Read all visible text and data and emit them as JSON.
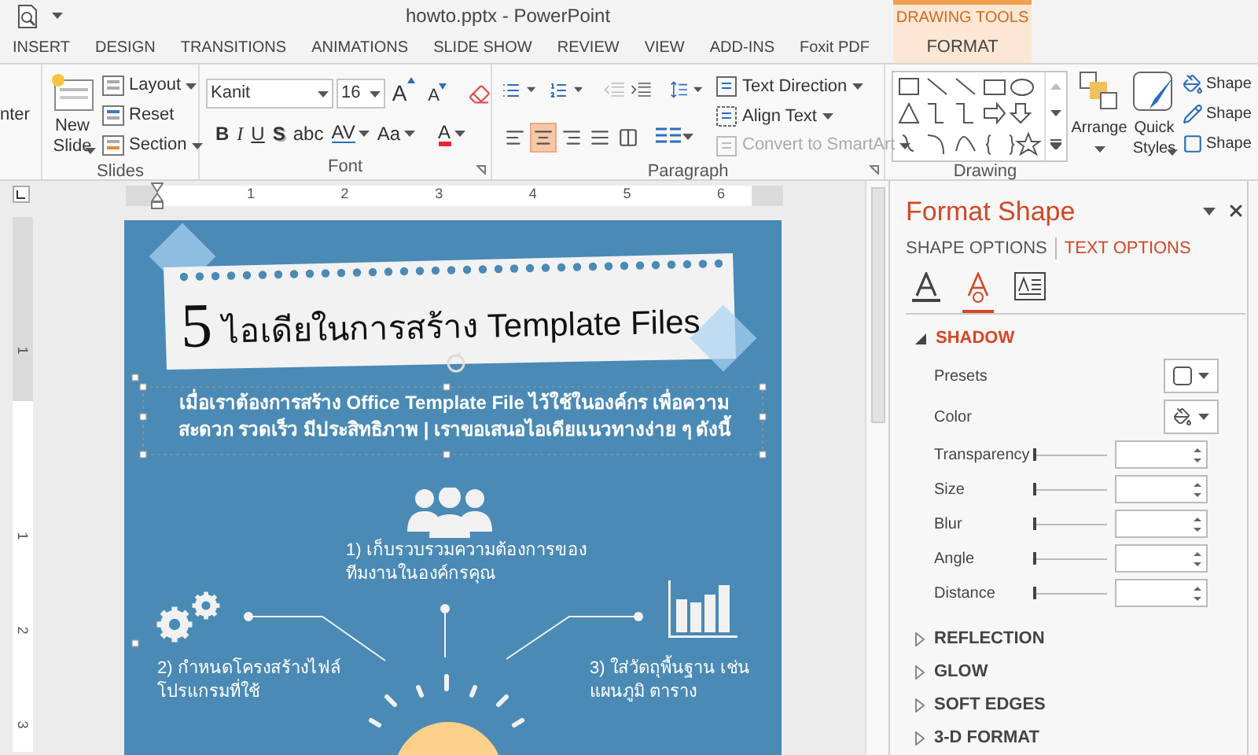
{
  "window": {
    "title": "howto.pptx - PowerPoint"
  },
  "contextual_group": {
    "label": "DRAWING TOOLS"
  },
  "ribbon_tabs": [
    {
      "label": "INSERT",
      "contextual": false
    },
    {
      "label": "DESIGN",
      "contextual": false
    },
    {
      "label": "TRANSITIONS",
      "contextual": false
    },
    {
      "label": "ANIMATIONS",
      "contextual": false
    },
    {
      "label": "SLIDE SHOW",
      "contextual": false
    },
    {
      "label": "REVIEW",
      "contextual": false
    },
    {
      "label": "VIEW",
      "contextual": false
    },
    {
      "label": "ADD-INS",
      "contextual": false
    },
    {
      "label": "Foxit PDF",
      "contextual": false
    },
    {
      "label": "FORMAT",
      "contextual": true
    }
  ],
  "ribbon": {
    "cut_group": {
      "text": "nter"
    },
    "slides": {
      "label": "Slides",
      "new_slide": "New Slide",
      "commands": [
        {
          "label": "Layout",
          "dropdown": true
        },
        {
          "label": "Reset",
          "dropdown": false
        },
        {
          "label": "Section",
          "dropdown": true
        }
      ]
    },
    "font": {
      "label": "Font",
      "name": "Kanit",
      "size": "16",
      "size_buttons": [
        {
          "label": "A",
          "kind": "grow"
        },
        {
          "label": "A",
          "kind": "shrink"
        }
      ],
      "format_buttons": [
        {
          "label": "B",
          "kind": "bold"
        },
        {
          "label": "I",
          "kind": "italic"
        },
        {
          "label": "U",
          "kind": "underline"
        },
        {
          "label": "S",
          "kind": "shadow"
        },
        {
          "label": "abc",
          "kind": "strike"
        },
        {
          "label": "AV",
          "kind": "spacing"
        },
        {
          "label": "Aa",
          "kind": "case"
        },
        {
          "label": "A",
          "kind": "color"
        }
      ]
    },
    "paragraph": {
      "label": "Paragraph",
      "alignments": [
        {
          "kind": "left",
          "selected": false
        },
        {
          "kind": "center",
          "selected": true
        },
        {
          "kind": "right",
          "selected": false
        },
        {
          "kind": "justify",
          "selected": false
        },
        {
          "kind": "distributed",
          "selected": false
        }
      ],
      "commands": [
        {
          "label": "Text Direction",
          "disabled": false
        },
        {
          "label": "Align Text",
          "disabled": false
        },
        {
          "label": "Convert to SmartArt",
          "disabled": true
        }
      ]
    },
    "drawing": {
      "label": "Drawing",
      "arrange": "Arrange",
      "quick_styles": "Quick Styles",
      "shape_commands": [
        {
          "label": "Shape",
          "kind": "fill"
        },
        {
          "label": "Shape",
          "kind": "outline"
        },
        {
          "label": "Shape",
          "kind": "effects"
        }
      ]
    }
  },
  "rulers": {
    "horizontal": [
      "1",
      "2",
      "3",
      "4",
      "5",
      "6"
    ],
    "vertical": [
      "1",
      "1",
      "2",
      "3"
    ]
  },
  "slide": {
    "title_number": "5",
    "title": "ไอเดียในการสร้าง Template Files",
    "intro": [
      "เมื่อเราต้องการสร้าง Office Template File ไว้ใช้ในองค์กร เพื่อความ",
      "สะดวก รวดเร็ว มีประสิทธิภาพ | เราขอเสนอไอเดียแนวทางง่าย ๆ ดังนี้"
    ],
    "points": [
      {
        "kind": "people",
        "lines": [
          "1) เก็บรวบรวมความต้องการของ",
          "ทีมงานในองค์กรคุณ"
        ]
      },
      {
        "kind": "gears",
        "lines": [
          "2) กำหนดโครงสร้างไฟล์",
          "โปรแกรมที่ใช้"
        ]
      },
      {
        "kind": "chart",
        "lines": [
          "3) ใส่วัตถุพื้นฐาน เช่น",
          "แผนภูมิ ตาราง"
        ]
      }
    ]
  },
  "format_pane": {
    "title": "Format Shape",
    "tabs": [
      {
        "label": "SHAPE OPTIONS",
        "selected": false
      },
      {
        "label": "TEXT OPTIONS",
        "selected": true
      }
    ],
    "icon_tabs": [
      {
        "kind": "fill",
        "selected": false
      },
      {
        "kind": "effects",
        "selected": true
      },
      {
        "kind": "textbox",
        "selected": false
      }
    ],
    "sections": [
      {
        "label": "SHADOW",
        "expanded": true,
        "rows": [
          {
            "label": "Presets",
            "kind": "preset"
          },
          {
            "label": "Color",
            "kind": "color"
          },
          {
            "label": "Transparency",
            "kind": "slider",
            "level": 0
          },
          {
            "label": "Size",
            "kind": "slider",
            "level": 0
          },
          {
            "label": "Blur",
            "kind": "slider",
            "level": 0
          },
          {
            "label": "Angle",
            "kind": "slider",
            "level": 0
          },
          {
            "label": "Distance",
            "kind": "slider",
            "level": 0
          }
        ]
      },
      {
        "label": "REFLECTION",
        "expanded": false
      },
      {
        "label": "GLOW",
        "expanded": false
      },
      {
        "label": "SOFT EDGES",
        "expanded": false
      },
      {
        "label": "3-D FORMAT",
        "expanded": false
      }
    ]
  }
}
